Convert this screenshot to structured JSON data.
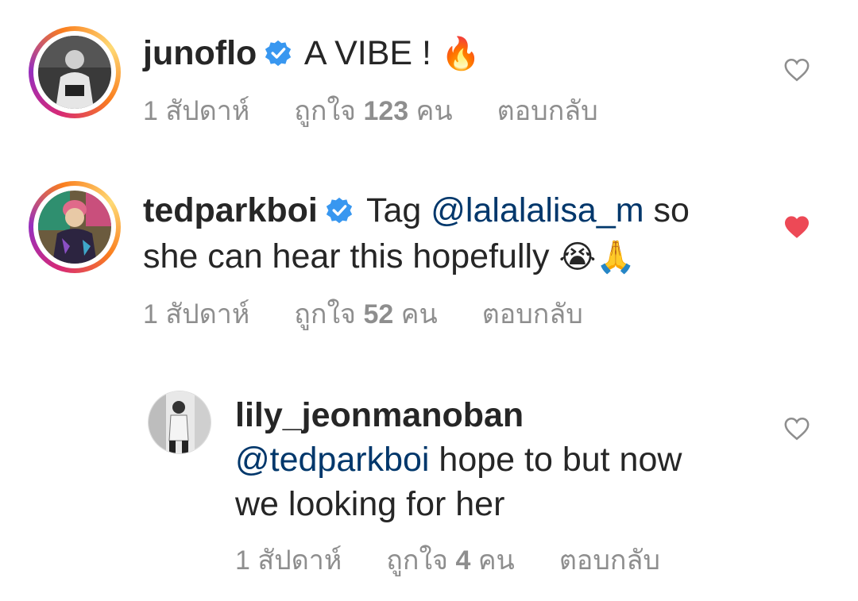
{
  "comments": [
    {
      "username": "junoflo",
      "verified": true,
      "text_plain": " A VIBE ! ",
      "emoji": "🔥",
      "time": "1 สัปดาห์",
      "likes_prefix": "ถูกใจ",
      "likes_count": "123",
      "likes_suffix": "คน",
      "reply": "ตอบกลับ",
      "liked": false
    },
    {
      "username": "tedparkboi",
      "verified": true,
      "text_before": " Tag ",
      "mention": "@lalalalisa_m",
      "text_after": " so",
      "line2": "she can hear this hopefully ",
      "emoji": "😭🙏",
      "time": "1 สัปดาห์",
      "likes_prefix": "ถูกใจ",
      "likes_count": "52",
      "likes_suffix": "คน",
      "reply": "ตอบกลับ",
      "liked": true
    }
  ],
  "reply": {
    "username": "lily_jeonmanoban",
    "mention": "@tedparkboi",
    "text1": " hope to but now",
    "text2": "we looking for her",
    "time": "1 สัปดาห์",
    "likes_prefix": "ถูกใจ",
    "likes_count": "4",
    "likes_suffix": "คน",
    "reply_label": "ตอบกลับ",
    "liked": false
  },
  "colors": {
    "text": "#262626",
    "meta": "#8e8e8e",
    "mention": "#00376b",
    "verified": "#3897f0",
    "liked_heart": "#ed4956"
  }
}
